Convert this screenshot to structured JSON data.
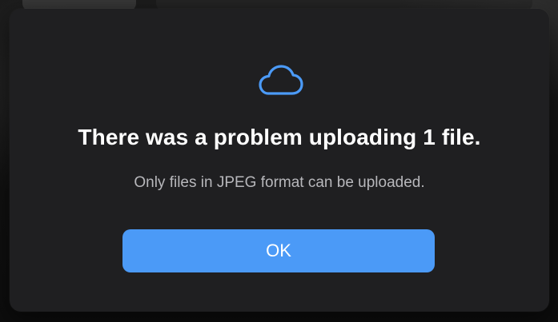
{
  "dialog": {
    "icon": "cloud-icon",
    "title": "There was a problem uploading 1 file.",
    "message": "Only files in JPEG format can be uploaded.",
    "ok_label": "OK"
  },
  "colors": {
    "dialog_background": "#1f1f21",
    "accent": "#4b9af7",
    "icon": "#4b9af7",
    "title_text": "#ffffff",
    "message_text": "#b7b7bb"
  }
}
